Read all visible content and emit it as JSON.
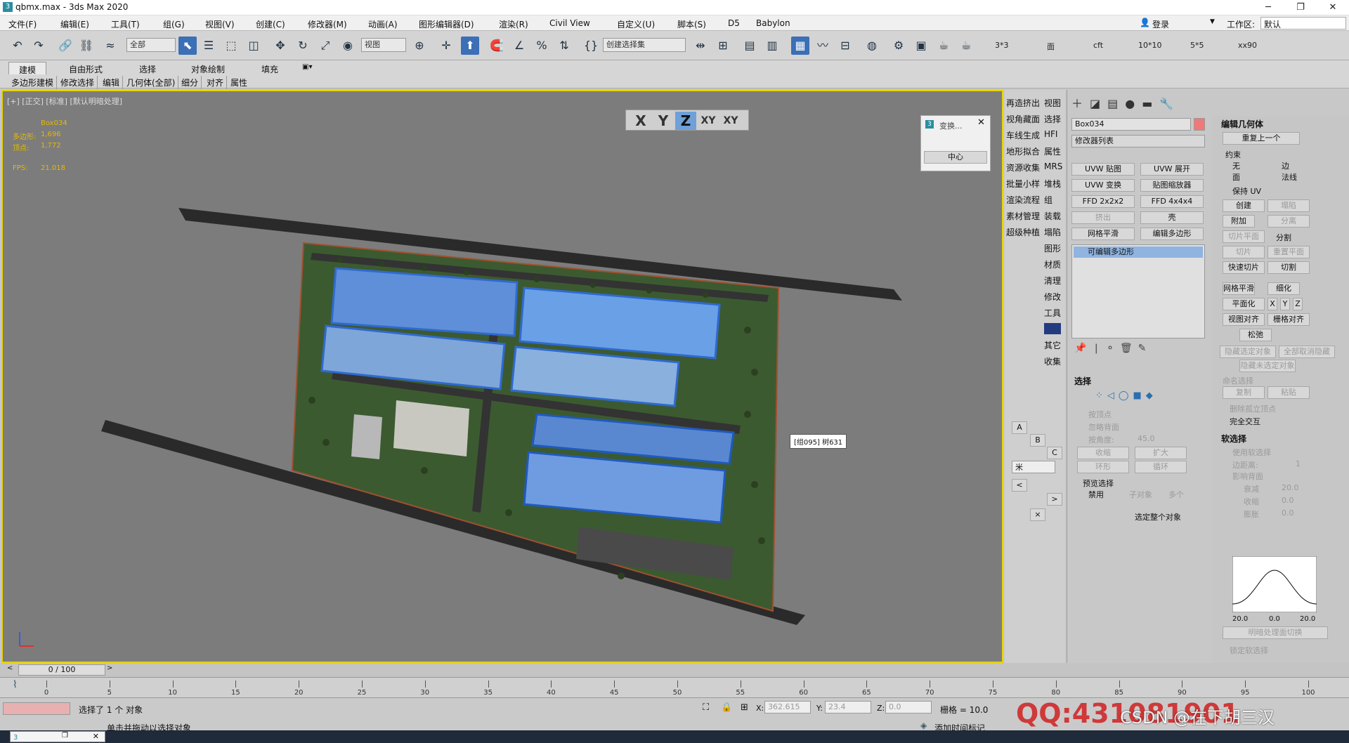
{
  "window": {
    "title": "qbmx.max - 3ds Max 2020",
    "icon": "3"
  },
  "menu": [
    "文件(F)",
    "编辑(E)",
    "工具(T)",
    "组(G)",
    "视图(V)",
    "创建(C)",
    "修改器(M)",
    "动画(A)",
    "图形编辑器(D)",
    "渲染(R)",
    "Civil View",
    "自定义(U)",
    "脚本(S)",
    "D5",
    "Babylon"
  ],
  "login": {
    "user_label": "登录",
    "workspace_label": "工作区:",
    "workspace_value": "默认"
  },
  "toolbar": {
    "selection_filter": "全部",
    "ref_coord": "视图",
    "named_selection": "创建选择集",
    "custom_labels": [
      "3*3",
      "面",
      "cft",
      "10*10",
      "5*5",
      "xx90"
    ]
  },
  "ribbon": {
    "tabs": [
      "建模",
      "自由形式",
      "选择",
      "对象绘制",
      "填充"
    ],
    "subtabs": [
      "多边形建模",
      "修改选择",
      "编辑",
      "几何体(全部)",
      "细分",
      "对齐",
      "属性"
    ]
  },
  "viewport": {
    "label": "[+] [正交] [标准] [默认明暗处理]",
    "stats": {
      "object": "Box034",
      "poly_label": "多边形:",
      "poly_value": "1,696",
      "vert_label": "顶点:",
      "vert_value": "1,772",
      "fps_label": "FPS:",
      "fps_value": "21.018"
    },
    "axis_buttons": [
      "X",
      "Y",
      "Z",
      "XY",
      "XY"
    ],
    "axis_active": "Z",
    "transform_dialog": {
      "title": "变换...",
      "center_label": "中心"
    },
    "tooltip": "[组095] 树631"
  },
  "script_panel": {
    "left": [
      "再造挤出",
      "视角藏面",
      "车线生成",
      "地形拟合",
      "资源收集",
      "批量小样",
      "渲染流程",
      "素材管理",
      "超级种植"
    ],
    "right": [
      "视图",
      "选择",
      "HFI",
      "属性",
      "MRS",
      "堆栈",
      "组",
      "装载",
      "塌陷",
      "图形",
      "材质",
      "清理",
      "修改",
      "工具",
      "",
      "其它",
      "收集"
    ],
    "small": [
      "A",
      "B",
      "C"
    ],
    "unit": "米",
    "arrows": [
      "<",
      ">",
      "×"
    ]
  },
  "command_panel": {
    "object_name": "Box034",
    "object_color": "#f07878",
    "modifier_list": "修改器列表",
    "mod_buttons": [
      [
        "UVW 贴图",
        "UVW 展开"
      ],
      [
        "UVW 变换",
        "贴图缩放器"
      ],
      [
        "FFD 2x2x2",
        "FFD 4x4x4"
      ],
      [
        "挤出",
        "壳"
      ],
      [
        "网格平滑",
        "编辑多边形"
      ]
    ],
    "stack_item": "可编辑多边形",
    "selection": {
      "header": "选择",
      "by_vertex": "按顶点",
      "ignore_back": "忽略背面",
      "by_angle": "按角度:",
      "angle": "45.0",
      "shrink": "收缩",
      "grow": "扩大",
      "ring": "环形",
      "loop": "循环",
      "preview": "预览选择",
      "disabled": "禁用",
      "subobject": "子对象",
      "multi": "多个",
      "whole": "选定整个对象"
    }
  },
  "edit_geometry": {
    "header": "编辑几何体",
    "repeat_last": "重复上一个",
    "constraints": "约束",
    "c_none": "无",
    "c_edge": "边",
    "c_face": "面",
    "c_normal": "法线",
    "preserve_uv": "保持 UV",
    "create": "创建",
    "collapse": "塌陷",
    "attach": "附加",
    "detach": "分离",
    "slice_plane": "切片平面",
    "split": "分割",
    "slice": "切片",
    "reset_plane": "重置平面",
    "quickslice": "快速切片",
    "cut": "切割",
    "meshsmooth": "网格平滑",
    "tessellate": "细化",
    "make_planar": "平面化",
    "x": "X",
    "y": "Y",
    "z": "Z",
    "view_align": "视图对齐",
    "grid_align": "栅格对齐",
    "relax": "松弛",
    "hide_sel": "隐藏选定对象",
    "unhide_all": "全部取消隐藏",
    "hide_unsel": "隐藏未选定对象",
    "named_sel": "命名选择",
    "copy": "复制",
    "paste": "粘贴",
    "delete_iso": "删除孤立顶点",
    "full_inter": "完全交互"
  },
  "soft_selection": {
    "header": "软选择",
    "use_soft": "使用软选择",
    "edge_dist": "边距离:",
    "edge_val": "1",
    "affect_back": "影响背面",
    "falloff": "衰减",
    "falloff_val": "20.0",
    "pinch": "收缩",
    "pinch_val": "0.0",
    "bubble": "膨胀",
    "bubble_val": "0.0",
    "curve_left": "20.0",
    "curve_mid": "0.0",
    "curve_right": "20.0",
    "shaded_face": "明暗处理面切换",
    "lock_soft": "锁定软选择"
  },
  "timeline": {
    "frame": "0 / 100",
    "ticks": [
      "0",
      "5",
      "10",
      "15",
      "20",
      "25",
      "30",
      "35",
      "40",
      "45",
      "50",
      "55",
      "60",
      "65",
      "70",
      "75",
      "80",
      "85",
      "90",
      "95",
      "100"
    ]
  },
  "status": {
    "selected": "选择了 1 个 对象",
    "hint": "单击并拖动以选择对象",
    "x_label": "X:",
    "x_val": "362.615",
    "y_label": "Y:",
    "y_val": "23.4",
    "z_label": "Z:",
    "z_val": "0.0",
    "grid": "栅格 = 10.0",
    "add_time_tag": "添加时间标记",
    "watermark": "QQ:431081901",
    "csdn": "CSDN @在下胡三汉"
  }
}
